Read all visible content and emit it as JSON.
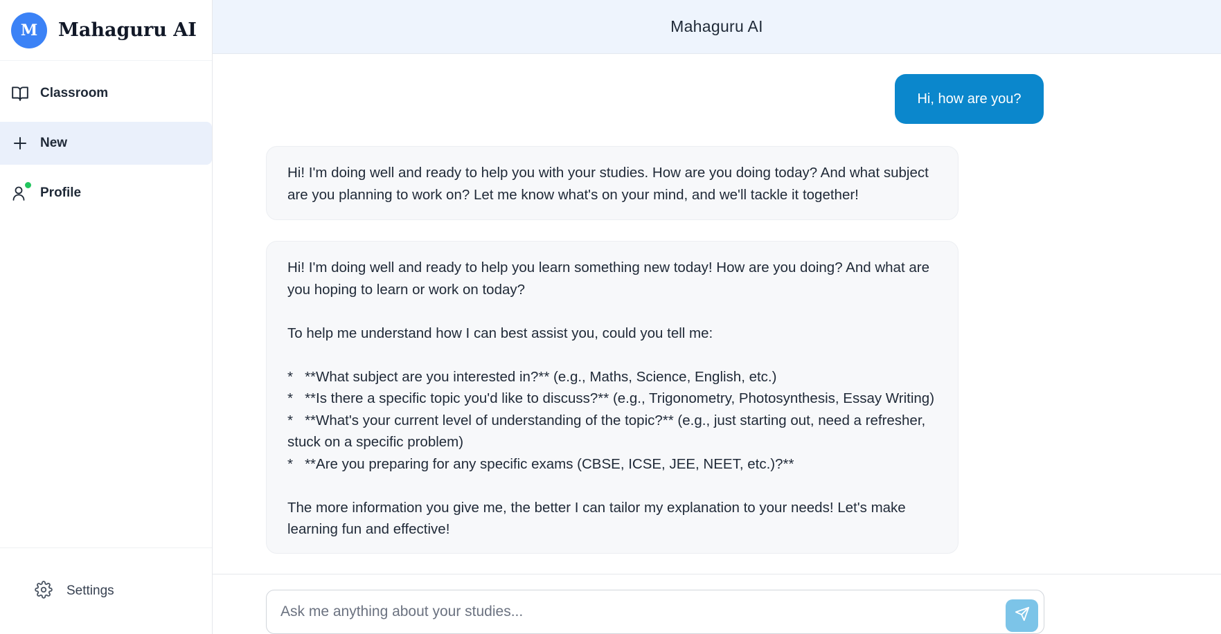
{
  "brand": {
    "initial": "M",
    "name": "Mahaguru AI"
  },
  "sidebar": {
    "items": [
      {
        "label": "Classroom",
        "icon": "book-icon"
      },
      {
        "label": "New",
        "icon": "plus-icon",
        "active": true
      },
      {
        "label": "Profile",
        "icon": "user-icon",
        "status": "online"
      }
    ],
    "settings_label": "Settings"
  },
  "header": {
    "title": "Mahaguru AI"
  },
  "messages": [
    {
      "role": "user",
      "text": "Hi, how are you?"
    },
    {
      "role": "assistant",
      "text": "Hi! I'm doing well and ready to help you with your studies. How are you doing today? And what subject are you planning to work on? Let me know what's on your mind, and we'll tackle it together!"
    },
    {
      "role": "assistant",
      "text": "Hi! I'm doing well and ready to help you learn something new today! How are you doing? And what are you hoping to learn or work on today?\n\nTo help me understand how I can best assist you, could you tell me:\n\n*   **What subject are you interested in?** (e.g., Maths, Science, English, etc.)\n*   **Is there a specific topic you'd like to discuss?** (e.g., Trigonometry, Photosynthesis, Essay Writing)\n*   **What's your current level of understanding of the topic?** (e.g., just starting out, need a refresher, stuck on a specific problem)\n*   **Are you preparing for any specific exams (CBSE, ICSE, JEE, NEET, etc.)?**\n\nThe more information you give me, the better I can tailor my explanation to your needs! Let's make learning fun and effective!"
    }
  ],
  "composer": {
    "placeholder": "Ask me anything about your studies...",
    "value": ""
  },
  "colors": {
    "accent": "#3b82f6",
    "user_bubble": "#0b87cc",
    "send_button": "#7cc4e8",
    "online": "#22c55e"
  }
}
